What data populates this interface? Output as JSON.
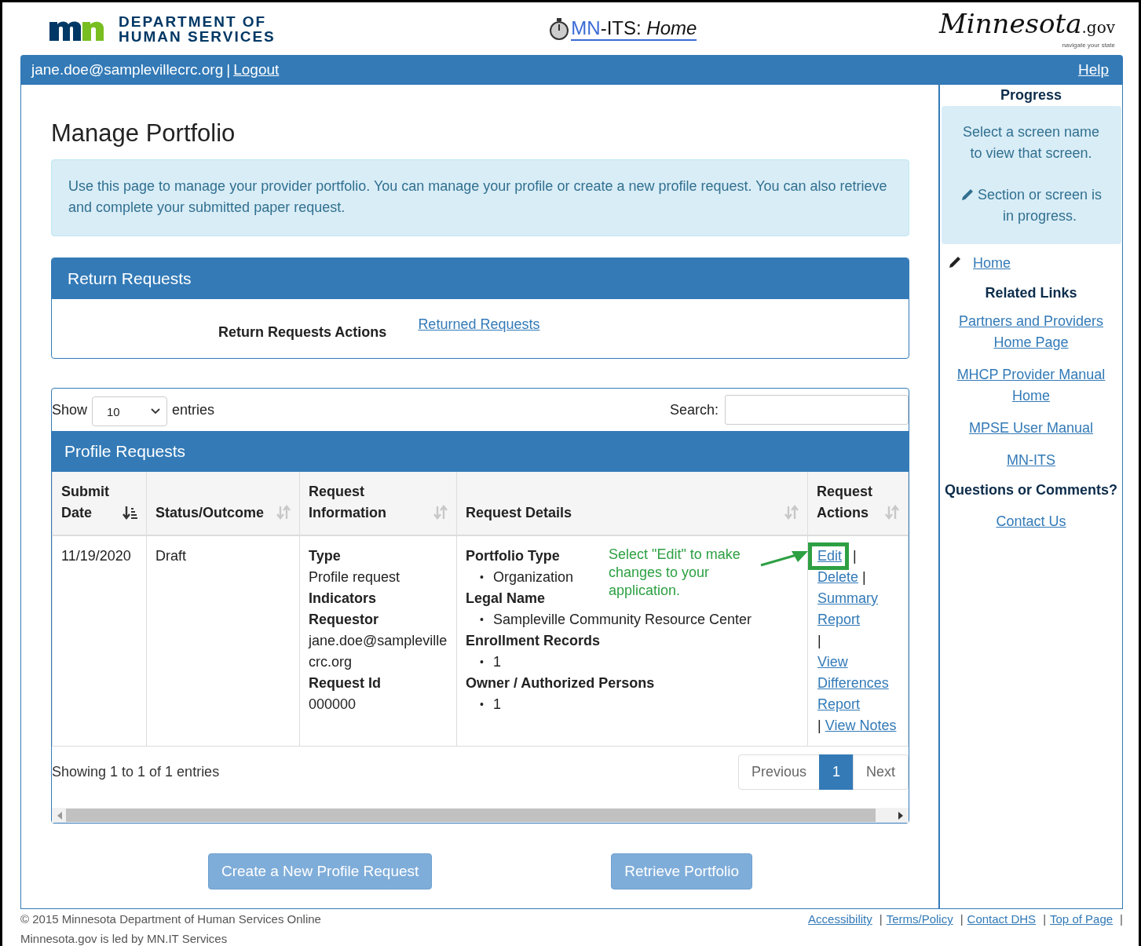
{
  "header": {
    "agency_line1": "DEPARTMENT OF",
    "agency_line2": "HUMAN SERVICES",
    "app_title_prefix": "MN",
    "app_title_rest": "-ITS:",
    "app_title_page": "Home",
    "state_logo": "Minnesota",
    "state_logo_suffix": ".gov",
    "state_tagline": "navigate your state"
  },
  "user_bar": {
    "email": "jane.doe@samplevillecrc.org",
    "separator": "|",
    "logout": "Logout",
    "help": "Help"
  },
  "page": {
    "title": "Manage Portfolio",
    "info": "Use this page to manage your provider portfolio. You can manage your profile or create a new profile request. You can also retrieve and complete your submitted paper request."
  },
  "return_panel": {
    "title": "Return Requests",
    "label": "Return Requests Actions",
    "link": "Returned Requests"
  },
  "table_controls": {
    "show_label": "Show",
    "page_size": "10",
    "entries_label": "entries",
    "search_label": "Search:"
  },
  "table": {
    "title": "Profile Requests",
    "columns": [
      {
        "label": "Submit Date",
        "sorted": true
      },
      {
        "label": "Status/Outcome",
        "sorted": false
      },
      {
        "label": "Request Information",
        "sorted": false
      },
      {
        "label": "Request Details",
        "sorted": false
      },
      {
        "label": "Request Actions",
        "sorted": false
      }
    ],
    "rows": [
      {
        "submit_date": "11/19/2020",
        "status": "Draft",
        "information": [
          {
            "kind": "label",
            "text": "Type"
          },
          {
            "kind": "value",
            "text": "Profile request"
          },
          {
            "kind": "label",
            "text": "Indicators"
          },
          {
            "kind": "label",
            "text": "Requestor"
          },
          {
            "kind": "value",
            "text": "jane.doe@samplevillecrc.org"
          },
          {
            "kind": "label",
            "text": "Request Id"
          },
          {
            "kind": "value",
            "text": "000000"
          }
        ],
        "details": [
          {
            "label": "Portfolio Type",
            "marker": "•",
            "items": [
              "Organization"
            ]
          },
          {
            "label": "Legal Name",
            "marker": "•",
            "items": [
              "Sampleville Community Resource Center"
            ]
          },
          {
            "label": "Enrollment Records",
            "marker": "•",
            "items": [
              "1"
            ]
          },
          {
            "label": "Owner / Authorized Persons",
            "marker": "•",
            "items": [
              "1"
            ]
          }
        ],
        "actions": [
          {
            "kind": "link",
            "text": "Edit",
            "highlighted": true
          },
          {
            "kind": "sep",
            "text": "|"
          },
          {
            "kind": "link",
            "text": "Delete",
            "highlighted": false
          },
          {
            "kind": "sep",
            "text": "|"
          },
          {
            "kind": "link",
            "text": "Summary Report",
            "highlighted": false
          },
          {
            "kind": "sep",
            "text": "|"
          },
          {
            "kind": "link",
            "text": "View Differences Report",
            "highlighted": false
          },
          {
            "kind": "sep",
            "text": "|"
          },
          {
            "kind": "link",
            "text": "View Notes",
            "highlighted": false
          }
        ]
      }
    ],
    "annotation": "Select \"Edit\" to make changes to your application.",
    "summary": "Showing 1 to 1 of 1 entries",
    "pagination": [
      {
        "label": "Previous",
        "selected": false
      },
      {
        "label": "1",
        "selected": true
      },
      {
        "label": "Next",
        "selected": false
      }
    ]
  },
  "buttons": [
    "Create a New Profile Request",
    "Retrieve Portfolio"
  ],
  "sidebar": {
    "title": "Progress",
    "hint": "Select a screen name to view that screen.",
    "legend": "Section or screen is in progress.",
    "progress_link": "Home",
    "related_title": "Related Links",
    "related_links": [
      "Partners and Providers Home Page",
      "MHCP Provider Manual Home",
      "MPSE User Manual",
      "MN-ITS"
    ],
    "questions_title": "Questions or Comments?",
    "contact_link": "Contact Us"
  },
  "footer": {
    "copyright": "© 2015 Minnesota Department of Human Services Online",
    "note": "Minnesota.gov is led by MN.IT Services",
    "links": [
      {
        "text": "Accessibility",
        "sep": "|"
      },
      {
        "text": "Terms/Policy",
        "sep": "|"
      },
      {
        "text": "Contact DHS",
        "sep": "|"
      },
      {
        "text": "Top of Page",
        "sep": "|"
      }
    ]
  }
}
